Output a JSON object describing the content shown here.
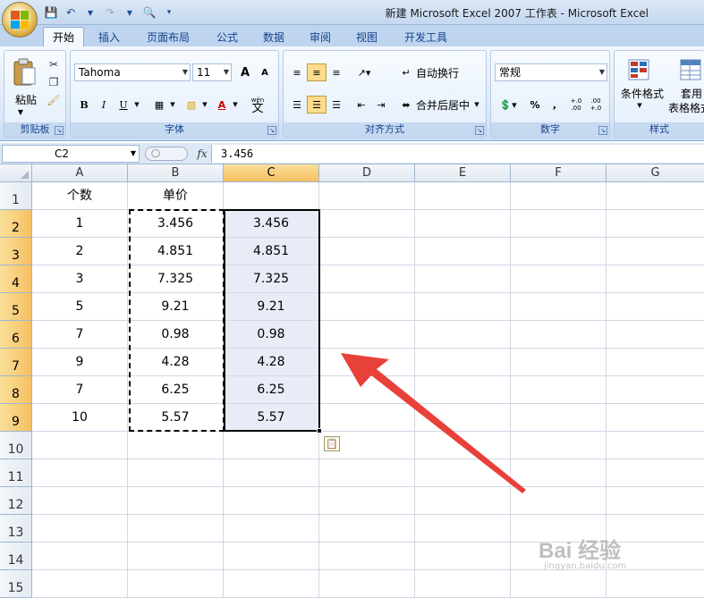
{
  "window": {
    "title": "新建 Microsoft Excel 2007 工作表 - Microsoft Excel"
  },
  "tabs": [
    {
      "label": "开始",
      "active": true
    },
    {
      "label": "插入",
      "active": false
    },
    {
      "label": "页面布局",
      "active": false
    },
    {
      "label": "公式",
      "active": false
    },
    {
      "label": "数据",
      "active": false
    },
    {
      "label": "审阅",
      "active": false
    },
    {
      "label": "视图",
      "active": false
    },
    {
      "label": "开发工具",
      "active": false
    }
  ],
  "ribbon": {
    "clipboard": {
      "label": "剪贴板",
      "paste_label": "粘贴"
    },
    "font": {
      "label": "字体",
      "font_name": "Tahoma",
      "font_size": "11",
      "bold": "B",
      "italic": "I",
      "underline": "U",
      "font_color": "A",
      "grow": "A",
      "shrink": "A",
      "wen": "wén",
      "wen_char": "文"
    },
    "alignment": {
      "label": "对齐方式",
      "wrap_text": "自动换行",
      "merge_center": "合并后居中"
    },
    "number": {
      "label": "数字",
      "format": "常规",
      "percent": "%",
      "comma": ",",
      "inc_decimal": "+.0 .00",
      "dec_decimal": ".00 +.0"
    },
    "styles": {
      "label": "样式",
      "conditional_format": "条件格式",
      "table_format_1": "套用",
      "table_format_2": "表格格式"
    }
  },
  "formula_bar": {
    "name_box": "C2",
    "fx": "fx",
    "value": "3.456"
  },
  "sheet": {
    "columns": [
      "A",
      "B",
      "C",
      "D",
      "E",
      "F",
      "G"
    ],
    "selected_column": "C",
    "rows": [
      "1",
      "2",
      "3",
      "4",
      "5",
      "6",
      "7",
      "8",
      "9",
      "10",
      "11",
      "12",
      "13",
      "14",
      "15"
    ],
    "selected_rows": [
      "2",
      "3",
      "4",
      "5",
      "6",
      "7",
      "8",
      "9"
    ],
    "cells": [
      [
        "个数",
        "单价",
        ""
      ],
      [
        "1",
        "3.456",
        "3.456"
      ],
      [
        "2",
        "4.851",
        "4.851"
      ],
      [
        "3",
        "7.325",
        "7.325"
      ],
      [
        "5",
        "9.21",
        "9.21"
      ],
      [
        "7",
        "0.98",
        "0.98"
      ],
      [
        "9",
        "4.28",
        "4.28"
      ],
      [
        "7",
        "6.25",
        "6.25"
      ],
      [
        "10",
        "5.57",
        "5.57"
      ]
    ]
  },
  "colors": {
    "annotation_arrow": "#e8413a",
    "selection_fill": "#e8ecf7",
    "header_selected": "#f5c063"
  },
  "watermark": {
    "text": "Bai 经验",
    "sub": "jingyan.baidu.com"
  }
}
